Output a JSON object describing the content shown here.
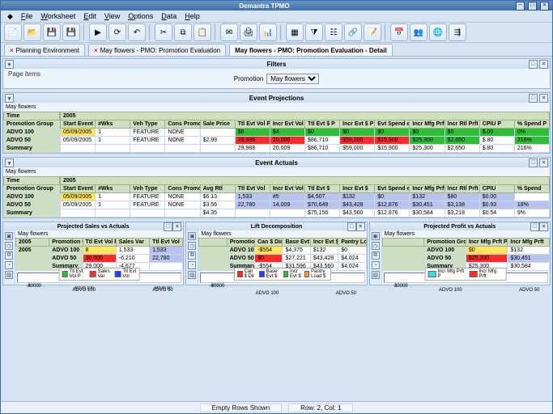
{
  "app": {
    "title": "Demantra TPMO"
  },
  "menu": [
    "File",
    "Worksheet",
    "Edit",
    "View",
    "Options",
    "Data",
    "Help"
  ],
  "tabs": [
    {
      "label": "Planning Environment",
      "closable": true
    },
    {
      "label": "May flowers - PMO: Promotion Evaluation",
      "closable": true
    },
    {
      "label": "May flowers - PMO: Promotion Evaluation - Detail",
      "closable": false,
      "active": true
    }
  ],
  "filters": {
    "title": "Filters",
    "page_items": "Page items",
    "promo_label": "Promotion",
    "promo_value": "May flowers"
  },
  "proj": {
    "title": "Event Projections",
    "context": "May flowers",
    "time_label": "Time",
    "year": "2005",
    "cols": [
      "Start Event P",
      "#Wks",
      "Veh Type",
      "Cons Promo",
      "Sale Price",
      "Ttl Evt Vol P",
      "Incr Evt Vol P",
      "Ttl Evt $ P",
      "Incr Evt $ P",
      "Evt Spend exS P",
      "Incr Mfg Prft P",
      "Incr Rtl Prft P",
      "CPIU P",
      "% Spend P"
    ],
    "rows": [
      {
        "label": "Promotion Group"
      },
      {
        "label": "ADVO 100",
        "cells": [
          {
            "v": "05/09/2005",
            "cls": "yellow"
          },
          {
            "v": "1"
          },
          {
            "v": "FEATURE"
          },
          {
            "v": "NONE"
          },
          {
            "v": ""
          },
          {
            "v": "$6",
            "cls": "green"
          },
          {
            "v": "$4",
            "cls": "green"
          },
          {
            "v": "$0",
            "cls": "green"
          },
          {
            "v": "$0",
            "cls": "green"
          },
          {
            "v": "$0",
            "cls": "green"
          },
          {
            "v": "$0",
            "cls": "green"
          },
          {
            "v": "$0",
            "cls": "green"
          },
          {
            "v": "$.00",
            "cls": "green"
          },
          {
            "v": "0%",
            "cls": "green"
          }
        ]
      },
      {
        "label": "ADVO 50",
        "cells": [
          {
            "v": "05/09/2005"
          },
          {
            "v": "1"
          },
          {
            "v": "FEATURE"
          },
          {
            "v": "NONE"
          },
          {
            "v": "$2.99"
          },
          {
            "v": "29,986",
            "cls": "red"
          },
          {
            "v": "20,006",
            "cls": "red"
          },
          {
            "v": "$86,710"
          },
          {
            "v": "$59,200",
            "cls": "red"
          },
          {
            "v": "$15,900",
            "cls": "red"
          },
          {
            "v": "$25,300",
            "cls": "green"
          },
          {
            "v": "$2,650",
            "cls": "green"
          },
          {
            "v": "$.80"
          },
          {
            "v": "216%",
            "cls": "green"
          }
        ]
      },
      {
        "label": "Summary",
        "cells": [
          {
            "v": ""
          },
          {
            "v": ""
          },
          {
            "v": ""
          },
          {
            "v": ""
          },
          {
            "v": ""
          },
          {
            "v": "29,988"
          },
          {
            "v": "20,009"
          },
          {
            "v": "$86,710"
          },
          {
            "v": "$59,000"
          },
          {
            "v": "$15,900"
          },
          {
            "v": "$25,300"
          },
          {
            "v": "$2,650"
          },
          {
            "v": "$.80"
          },
          {
            "v": "216%"
          }
        ]
      }
    ]
  },
  "act": {
    "title": "Event Actuals",
    "context": "May flowers",
    "time_label": "Time",
    "year": "2005",
    "cols": [
      "Start Event",
      "#Wks",
      "Veh Type",
      "Cons Promo",
      "Avg Rtl",
      "Ttl Evt Vol",
      "Incr Evt Vol",
      "Ttl Evt $",
      "Incr Evt $",
      "Evt Spend exS",
      "Incr Mfg Prft",
      "Incr Rtl Prft",
      "CPIU",
      "% Spend"
    ],
    "rows": [
      {
        "label": "Promotion Group"
      },
      {
        "label": "ADVO 100",
        "cells": [
          {
            "v": "05/09/2005",
            "cls": "yellow"
          },
          {
            "v": "1"
          },
          {
            "v": "FEATURE"
          },
          {
            "v": "NONE"
          },
          {
            "v": "$6.13"
          },
          {
            "v": "1,533",
            "cls": "lav"
          },
          {
            "v": "#5",
            "cls": "lav"
          },
          {
            "v": "$4,507",
            "cls": "lav"
          },
          {
            "v": "$132",
            "cls": "lav"
          },
          {
            "v": "$0",
            "cls": "lav"
          },
          {
            "v": "$132",
            "cls": "lav"
          },
          {
            "v": "$80",
            "cls": "lav"
          },
          {
            "v": "$0.00",
            "cls": "lav"
          },
          {
            "v": ""
          }
        ]
      },
      {
        "label": "ADVO 50",
        "cells": [
          {
            "v": "05/09/2005"
          },
          {
            "v": "1"
          },
          {
            "v": "FEATURE"
          },
          {
            "v": "NONE"
          },
          {
            "v": "$3.56"
          },
          {
            "v": "22,780",
            "cls": "lav"
          },
          {
            "v": "14,009",
            "cls": "lav"
          },
          {
            "v": "$70,649",
            "cls": "lav"
          },
          {
            "v": "$43,428",
            "cls": "lav"
          },
          {
            "v": "$12,876",
            "cls": "lav"
          },
          {
            "v": "$30,451",
            "cls": "lav"
          },
          {
            "v": "$3,138",
            "cls": "lav"
          },
          {
            "v": "$0.93",
            "cls": "lav"
          },
          {
            "v": "18%",
            "cls": "lav"
          }
        ]
      },
      {
        "label": "Summary",
        "cells": [
          {
            "v": ""
          },
          {
            "v": ""
          },
          {
            "v": ""
          },
          {
            "v": ""
          },
          {
            "v": "$4.35"
          },
          {
            "v": ""
          },
          {
            "v": ""
          },
          {
            "v": "$75,156"
          },
          {
            "v": "$43,560"
          },
          {
            "v": "$12,876"
          },
          {
            "v": "$30,584"
          },
          {
            "v": "$3,218"
          },
          {
            "v": "$0.54"
          },
          {
            "v": "9%"
          }
        ]
      }
    ]
  },
  "panel_sales": {
    "title": "Projected Sales vs Actuals",
    "context": "May flowers",
    "year": "2005",
    "cols": [
      "Ttl Evt Vol P",
      "Sales Var",
      "Ttl Evt Vol"
    ],
    "rows": [
      {
        "label": "ADVO 100",
        "cells": [
          {
            "v": "8",
            "cls": "yellow"
          },
          {
            "v": "1,533"
          },
          {
            "v": "1,533",
            "cls": "lav"
          }
        ]
      },
      {
        "label": "ADVO 50",
        "cells": [
          {
            "v": "30,000",
            "cls": "red"
          },
          {
            "v": "-6,210"
          },
          {
            "v": "22,780",
            "cls": "lav"
          }
        ]
      },
      {
        "label": "Summary",
        "cells": [
          {
            "v": "29,000"
          },
          {
            "v": "-4,677"
          },
          {
            "v": ""
          }
        ]
      }
    ]
  },
  "panel_lift": {
    "title": "Lift Decomposition",
    "context": "May flowers",
    "cols": [
      "Can $ Dir",
      "Base Evt $",
      "Incr Evt $",
      "Pantry Load $"
    ],
    "rows": [
      {
        "label": "ADVO 100",
        "cells": [
          {
            "v": "-$554",
            "cls": "yellow"
          },
          {
            "v": "$4,375"
          },
          {
            "v": "$132"
          },
          {
            "v": "$0"
          }
        ]
      },
      {
        "label": "ADVO 50",
        "cells": [
          {
            "v": "$0",
            "cls": "red"
          },
          {
            "v": "$27,221"
          },
          {
            "v": "$43,428"
          },
          {
            "v": "$4,024"
          }
        ]
      },
      {
        "label": "Summary",
        "cells": [
          {
            "v": "-$554"
          },
          {
            "v": "$31,596"
          },
          {
            "v": "$43,560"
          },
          {
            "v": "$4,024"
          }
        ]
      }
    ]
  },
  "panel_profit": {
    "title": "Projected Profit vs Actuals",
    "context": "May flowers",
    "cols": [
      "Incr Mfg Prft P",
      "Incr Mfg Prft"
    ],
    "rows": [
      {
        "label": "ADVO 100",
        "cells": [
          {
            "v": "$0",
            "cls": "yellow"
          },
          {
            "v": "$132"
          }
        ]
      },
      {
        "label": "ADVO 50",
        "cells": [
          {
            "v": "$25,300",
            "cls": "red"
          },
          {
            "v": "$30,451",
            "cls": "lav"
          }
        ]
      },
      {
        "label": "Summary",
        "cells": [
          {
            "v": "$25,300"
          },
          {
            "v": "$30,584"
          }
        ]
      }
    ]
  },
  "status": {
    "left": "Empty Rows Shown",
    "right": "Row: 2, Col: 1"
  },
  "chart_data": [
    {
      "id": "sales",
      "type": "bar",
      "title": "2005",
      "categories": [
        "ADVO 100",
        "ADVO 50"
      ],
      "series": [
        {
          "name": "Ttl Evt Vol P",
          "values": [
            8,
            30000
          ]
        },
        {
          "name": "Sales Var",
          "values": [
            1533,
            -6210
          ]
        },
        {
          "name": "Ttl Evt Vol",
          "values": [
            1533,
            22780
          ]
        }
      ],
      "ylim": [
        -20000,
        60000
      ],
      "yticks": [
        -20000,
        0,
        20000,
        40000,
        60000
      ],
      "legend": [
        "Ttl Evt Vol P",
        "Sales Var",
        "Ttl Evt Vol"
      ]
    },
    {
      "id": "lift",
      "type": "bar",
      "title": "2005",
      "categories": [
        "ADVO 100",
        "ADVO 50"
      ],
      "series": [
        {
          "name": "Can $ Dir",
          "values": [
            -554,
            0
          ]
        },
        {
          "name": "Base Evt $",
          "values": [
            4375,
            27221
          ]
        },
        {
          "name": "Incr Evt $",
          "values": [
            132,
            43428
          ]
        },
        {
          "name": "Pantry Load $",
          "values": [
            0,
            4024
          ]
        }
      ],
      "ylim": [
        -20000,
        80000
      ],
      "yticks": [
        -20000,
        0,
        20000,
        40000,
        60000,
        80000
      ],
      "legend": [
        "Can $ Dir",
        "Base Evt $",
        "Incr Evt $",
        "Pantry Load $"
      ]
    },
    {
      "id": "profit",
      "type": "bar",
      "title": "2005",
      "categories": [
        "ADVO 100",
        "ADVO 50"
      ],
      "series": [
        {
          "name": "Incr Mfg Prft P",
          "values": [
            0,
            25300
          ]
        },
        {
          "name": "Incr Mfg Prft",
          "values": [
            132,
            30451
          ]
        }
      ],
      "ylim": [
        0,
        40000
      ],
      "yticks": [
        0,
        10000,
        20000,
        30000,
        40000
      ],
      "legend": [
        "Incr Mfg Prft P",
        "Incr Mfg Prft"
      ]
    }
  ]
}
